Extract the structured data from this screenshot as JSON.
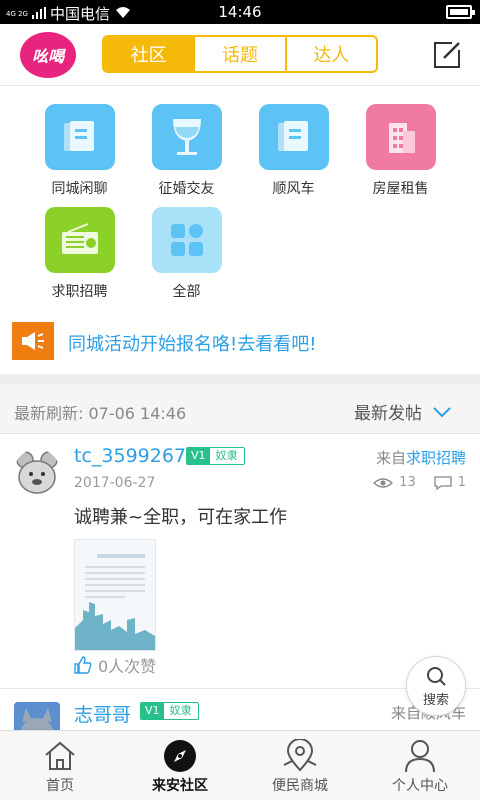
{
  "status_bar": {
    "network": "4G 2G",
    "carrier": "中国电信",
    "time": "14:46"
  },
  "header": {
    "logo_text": "吆喝",
    "tabs": [
      {
        "label": "社区",
        "active": true
      },
      {
        "label": "话题",
        "active": false
      },
      {
        "label": "达人",
        "active": false
      }
    ],
    "accent": "#f5b90a"
  },
  "categories": [
    {
      "label": "同城闲聊",
      "icon": "document-icon",
      "color": "#5cc3f4"
    },
    {
      "label": "征婚交友",
      "icon": "wine-glass-icon",
      "color": "#5cc3f4"
    },
    {
      "label": "顺风车",
      "icon": "document-icon",
      "color": "#5cc3f4"
    },
    {
      "label": "房屋租售",
      "icon": "building-icon",
      "color": "#f07aa0"
    },
    {
      "label": "求职招聘",
      "icon": "radio-icon",
      "color": "#8bd12a"
    },
    {
      "label": "全部",
      "icon": "grid-icon",
      "color": "#a9e1f8"
    }
  ],
  "notice": {
    "text": "同城活动开始报名咯!去看看吧!",
    "icon": "speaker-icon",
    "color": "#f07d0f"
  },
  "feed_bar": {
    "refresh_label": "最新刷新: 07-06 14:46",
    "sort_label": "最新发帖"
  },
  "posts": [
    {
      "username": "tc_3599267",
      "level": "V1",
      "rank": "奴隶",
      "from_prefix": "来自",
      "from_category": "求职招聘",
      "date": "2017-06-27",
      "views": "13",
      "comments": "1",
      "content": "诚聘兼~全职，可在家工作",
      "likes": "0人次赞"
    },
    {
      "username": "志哥哥",
      "level": "V1",
      "rank": "奴隶",
      "from_prefix": "来自",
      "from_category": "顺风车"
    }
  ],
  "search_fab": {
    "label": "搜索"
  },
  "bottom_nav": [
    {
      "label": "首页",
      "icon": "home-icon",
      "active": false
    },
    {
      "label": "来安社区",
      "icon": "compass-icon",
      "active": true
    },
    {
      "label": "便民商城",
      "icon": "map-pin-icon",
      "active": false
    },
    {
      "label": "个人中心",
      "icon": "person-icon",
      "active": false
    }
  ]
}
